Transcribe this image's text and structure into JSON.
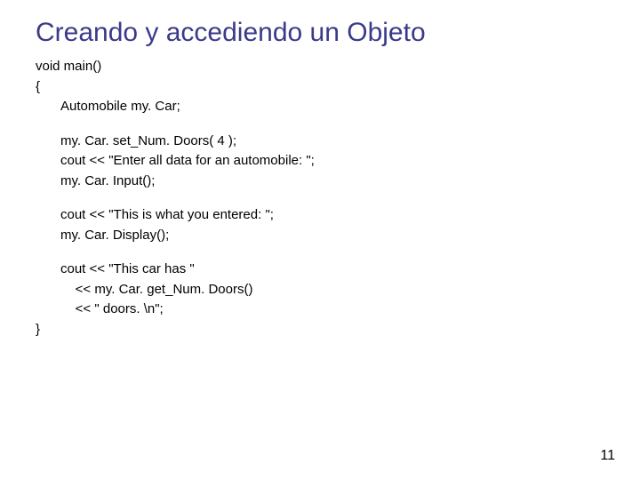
{
  "title": "Creando y accediendo un Objeto",
  "code": {
    "fn_sig": "void main()",
    "open_brace": "{",
    "line1": "Automobile my. Car;",
    "line2": "my. Car. set_Num. Doors( 4 );",
    "line3": "cout << \"Enter all data for an automobile: \";",
    "line4": "my. Car. Input();",
    "line5": "cout << \"This is what you entered: \";",
    "line6": "my. Car. Display();",
    "line7": "cout << \"This car has \"",
    "line8": "    << my. Car. get_Num. Doors()",
    "line9": "    << \" doors. \\n\";",
    "close_brace": "}"
  },
  "page_number": "11"
}
